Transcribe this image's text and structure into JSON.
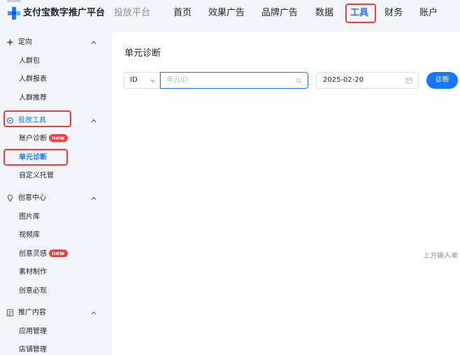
{
  "header": {
    "brand": "支付宝数字推广平台",
    "platform": "投放平台",
    "nav": [
      {
        "label": "首页"
      },
      {
        "label": "效果广告"
      },
      {
        "label": "品牌广告"
      },
      {
        "label": "数据"
      },
      {
        "label": "工具"
      },
      {
        "label": "财务"
      },
      {
        "label": "账户"
      }
    ],
    "active_nav": "工具",
    "accent_color": "#1677ff",
    "annotation_color": "#e8403a"
  },
  "sidebar": {
    "groups": [
      {
        "label": "定向",
        "icon": "crosshair-icon",
        "items": [
          {
            "label": "人群包"
          },
          {
            "label": "人群报表"
          },
          {
            "label": "人群推荐"
          }
        ]
      },
      {
        "label": "投放工具",
        "icon": "tool-icon",
        "items": [
          {
            "label": "账户诊断",
            "badge": "new"
          },
          {
            "label": "单元诊断"
          },
          {
            "label": "自定义托管"
          }
        ]
      },
      {
        "label": "创意中心",
        "icon": "bulb-icon",
        "items": [
          {
            "label": "图片库"
          },
          {
            "label": "视频库"
          },
          {
            "label": "创意灵感",
            "badge": "new"
          },
          {
            "label": "素材制作"
          },
          {
            "label": "创意必现"
          }
        ]
      },
      {
        "label": "推广内容",
        "icon": "document-icon",
        "items": [
          {
            "label": "应用管理"
          },
          {
            "label": "店铺管理"
          }
        ]
      }
    ],
    "active_group": "投放工具",
    "active_item": "单元诊断"
  },
  "main": {
    "title": "单元诊断",
    "filter": {
      "type_value": "ID",
      "search_placeholder": "单元ID",
      "date_value": "2025-02-20",
      "submit_label": "诊断"
    },
    "empty_hint": "上方输入单"
  }
}
